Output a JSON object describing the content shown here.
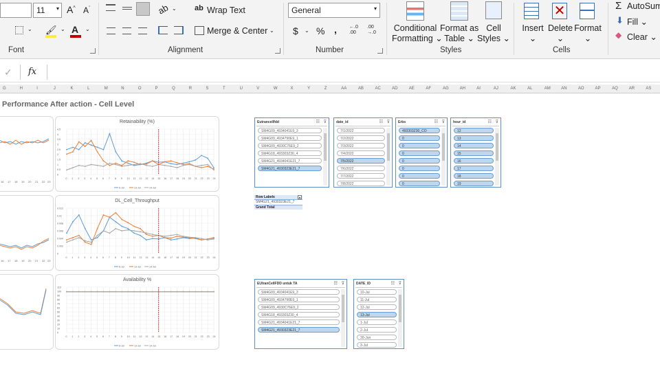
{
  "ribbon": {
    "font": {
      "size": "11",
      "grow_label": "A",
      "shrink_label": "A",
      "group_label": "Font",
      "fill_color": "#ffeb3b",
      "font_color": "#c00000"
    },
    "alignment": {
      "wrap_text": "Wrap Text",
      "merge_center": "Merge & Center",
      "group_label": "Alignment"
    },
    "number": {
      "format": "General",
      "currency": "$",
      "percent": "%",
      "comma": ",",
      "increase_decimal": "←.0 .00",
      "decrease_decimal": ".00 →.0",
      "group_label": "Number"
    },
    "styles": {
      "conditional": [
        "Conditional",
        "Formatting"
      ],
      "format_table": [
        "Format as",
        "Table"
      ],
      "cell_styles": [
        "Cell",
        "Styles"
      ],
      "group_label": "Styles"
    },
    "cells": {
      "insert": "Insert",
      "delete": "Delete",
      "format": "Format",
      "group_label": "Cells"
    },
    "editing": {
      "autosum": "AutoSum",
      "fill": "Fill",
      "clear": "Clear"
    }
  },
  "formula_bar": {
    "check": "✓",
    "fx": "fx",
    "value": ""
  },
  "columns": [
    "G",
    "H",
    "I",
    "J",
    "K",
    "L",
    "M",
    "N",
    "O",
    "P",
    "Q",
    "R",
    "S",
    "T",
    "U",
    "V",
    "W",
    "X",
    "Y",
    "Z",
    "AA",
    "AB",
    "AC",
    "AD",
    "AE",
    "AF",
    "AG",
    "AH",
    "AI",
    "AJ",
    "AK",
    "AL",
    "AM",
    "AN",
    "AO",
    "AP",
    "AQ",
    "AR",
    "AS"
  ],
  "sheet": {
    "title": "Performance After action - Cell Level"
  },
  "charts": {
    "retainability": {
      "title": "Retainability (%)"
    },
    "throughput": {
      "title": "DL_Cell_Throughput"
    },
    "availability": {
      "title": "Availability %"
    },
    "legend": [
      "6-Jul",
      "13-Jul",
      "14-Jul"
    ]
  },
  "slicers": {
    "eutrancell": {
      "header": "Eutrancellfdd",
      "items": [
        {
          "label": "SM4G09_4934041E9_3",
          "sel": false
        },
        {
          "label": "SM4G09_4934790E9_1",
          "sel": false
        },
        {
          "label": "SM4G09_4930C76E9_2",
          "sel": false
        },
        {
          "label": "SM4G18_493303Z30_4",
          "sel": false
        },
        {
          "label": "SM4G21_4934041E21_7",
          "sel": false
        },
        {
          "label": "SM4G21_4930323E21_7",
          "sel": true
        }
      ]
    },
    "date_id": {
      "header": "date_id",
      "items": [
        {
          "label": "7/1/2022",
          "sel": false
        },
        {
          "label": "7/2/2022",
          "sel": false
        },
        {
          "label": "7/3/2022",
          "sel": false
        },
        {
          "label": "7/4/2022",
          "sel": false
        },
        {
          "label": "7/5/2022",
          "sel": true
        },
        {
          "label": "7/6/2022",
          "sel": false
        },
        {
          "label": "7/7/2022",
          "sel": false
        },
        {
          "label": "7/8/2022",
          "sel": false
        }
      ]
    },
    "erbs": {
      "header": "Erbs",
      "items": [
        {
          "label": "493303Z30_CO",
          "sel": true
        },
        {
          "label": "0",
          "sel": true
        },
        {
          "label": "0",
          "sel": true
        },
        {
          "label": "0",
          "sel": true
        },
        {
          "label": "0",
          "sel": true
        },
        {
          "label": "0",
          "sel": true
        },
        {
          "label": "0",
          "sel": true
        },
        {
          "label": "0",
          "sel": true
        }
      ]
    },
    "hour_id": {
      "header": "hour_id",
      "items": [
        {
          "label": "12",
          "sel": true
        },
        {
          "label": "13",
          "sel": true
        },
        {
          "label": "14",
          "sel": true
        },
        {
          "label": "15",
          "sel": true
        },
        {
          "label": "16",
          "sel": true
        },
        {
          "label": "17",
          "sel": true
        },
        {
          "label": "18",
          "sel": true
        },
        {
          "label": "19",
          "sel": true
        }
      ]
    },
    "eutrancell_ta": {
      "header": "EUtranCellFDD untuk TA",
      "items": [
        {
          "label": "SM4G09_4934041E9_3",
          "sel": false
        },
        {
          "label": "SM4G09_4934790E9_1",
          "sel": false
        },
        {
          "label": "SM4G09_4930C76E9_2",
          "sel": false
        },
        {
          "label": "SM4G18_493303Z30_4",
          "sel": false
        },
        {
          "label": "SM4G21_4934041E21_7",
          "sel": false
        },
        {
          "label": "SM4G21_4930323E21_7",
          "sel": true
        }
      ]
    },
    "date_id2": {
      "header": "DATE_ID",
      "items": [
        {
          "label": "10-Jul",
          "sel": false
        },
        {
          "label": "11-Jul",
          "sel": false
        },
        {
          "label": "12-Jul",
          "sel": false
        },
        {
          "label": "13-Jul",
          "sel": true
        },
        {
          "label": "1-Jul",
          "sel": false
        },
        {
          "label": "2-Jul",
          "sel": false
        },
        {
          "label": "30-Jun",
          "sel": false
        },
        {
          "label": "3-Jul",
          "sel": false
        }
      ]
    }
  },
  "pivot": {
    "header": "Row Labels",
    "row": "SM4G21_4930323E21_7",
    "total": "Grand Total"
  }
}
